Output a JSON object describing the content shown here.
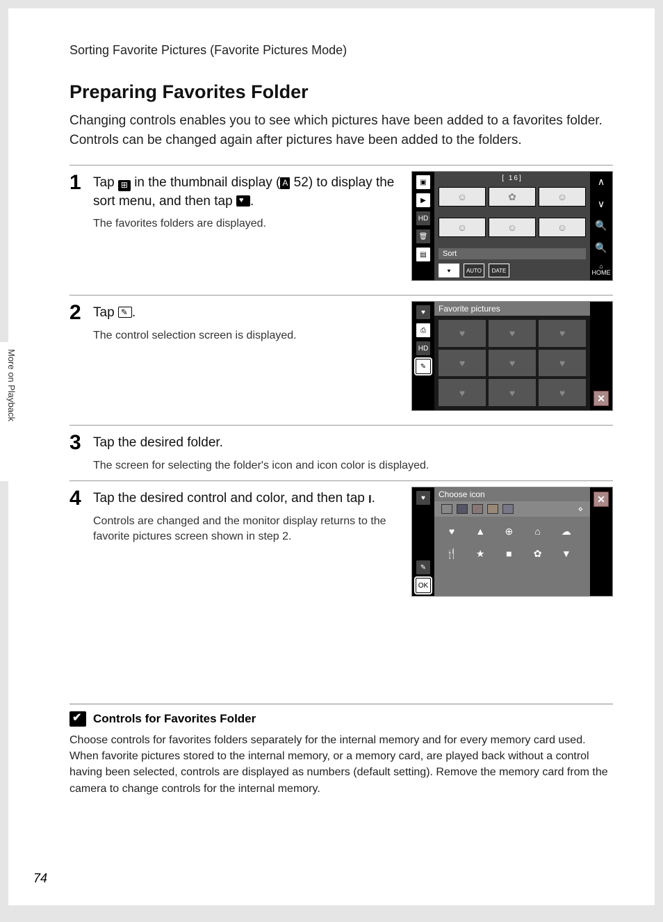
{
  "breadcrumb": "Sorting Favorite Pictures (Favorite Pictures Mode)",
  "side_tab": "More on Playback",
  "page_number": "74",
  "heading": "Preparing Favorites Folder",
  "intro": "Changing controls enables you to see which pictures have been added to a favorites folder. Controls can be changed again after pictures have been added to the folders.",
  "steps": {
    "s1": {
      "num": "1",
      "title_a": "Tap ",
      "title_b": " in the thumbnail display (",
      "ref": "A",
      "page_ref": "52",
      "title_c": ") to display the sort menu, and then tap ",
      "title_d": ".",
      "sub": "The favorites folders are displayed."
    },
    "s2": {
      "num": "2",
      "title_a": "Tap ",
      "title_b": ".",
      "sub": "The control selection screen is displayed."
    },
    "s3": {
      "num": "3",
      "title": "Tap the desired folder.",
      "sub": "The screen for selecting the folder's icon and icon color is displayed."
    },
    "s4": {
      "num": "4",
      "title_a": "Tap the desired control and color, and then tap ",
      "ok": "I",
      "title_b": ".",
      "sub": "Controls are changed and the monitor display returns to the favorite pictures screen shown in step 2."
    }
  },
  "scr1": {
    "counter": "[    16]",
    "sort_label": "Sort",
    "sort_options": {
      "fav": "♥",
      "auto": "AUTO",
      "date": "DATE"
    },
    "home_label": "HOME"
  },
  "scr2": {
    "header": "Favorite pictures"
  },
  "scr3": {
    "header": "Choose icon",
    "colors": [
      "#333",
      "#556",
      "#877",
      "#987",
      "#778"
    ],
    "icons_row1": [
      "♥",
      "▲",
      "⊕",
      "⌂",
      "☁"
    ],
    "icons_row2": [
      "🍴",
      "★",
      "■",
      "✿",
      "▼"
    ]
  },
  "note": {
    "title": "Controls for Favorites Folder",
    "body": "Choose controls for favorites folders separately for the internal memory and for every memory card used. When favorite pictures stored to the internal memory, or a memory card, are played back without a control having been selected, controls are displayed as numbers (default setting). Remove the memory card from the camera to change controls for the internal memory."
  }
}
